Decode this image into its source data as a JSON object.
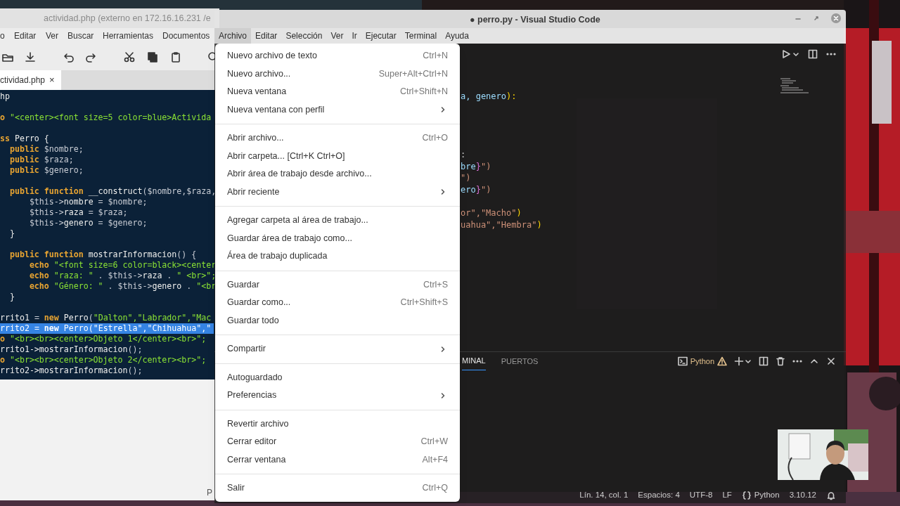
{
  "gedit": {
    "title": "actividad.php (externo en 172.16.16.231 /e",
    "menu": [
      "o",
      "Editar",
      "Ver",
      "Buscar",
      "Herramientas",
      "Documentos"
    ],
    "tab": {
      "label": "ctividad.php",
      "close": "×"
    },
    "code_lines": [
      {
        "kind": "code",
        "selected": false,
        "tokens": [
          {
            "kind": "plain",
            "text": "hp"
          }
        ]
      },
      {
        "kind": "blank"
      },
      {
        "kind": "code",
        "selected": false,
        "tokens": [
          {
            "kind": "keyword",
            "text": "o"
          },
          {
            "kind": "string",
            "text": " \"<center><font size=5 color=blue>Activida"
          }
        ]
      },
      {
        "kind": "blank"
      },
      {
        "kind": "code",
        "selected": false,
        "tokens": [
          {
            "kind": "keyword",
            "text": "ss"
          },
          {
            "kind": "plain",
            "text": " Perro {"
          }
        ]
      },
      {
        "kind": "code",
        "selected": false,
        "tokens": [
          {
            "kind": "keyword",
            "text": "  public"
          },
          {
            "kind": "variable",
            "text": " $nombre;"
          }
        ]
      },
      {
        "kind": "code",
        "selected": false,
        "tokens": [
          {
            "kind": "keyword",
            "text": "  public"
          },
          {
            "kind": "variable",
            "text": " $raza;"
          }
        ]
      },
      {
        "kind": "code",
        "selected": false,
        "tokens": [
          {
            "kind": "keyword",
            "text": "  public"
          },
          {
            "kind": "variable",
            "text": " $genero;"
          }
        ]
      },
      {
        "kind": "blank"
      },
      {
        "kind": "code",
        "selected": false,
        "tokens": [
          {
            "kind": "keyword",
            "text": "  public function"
          },
          {
            "kind": "plain",
            "text": " __construct"
          },
          {
            "kind": "variable",
            "text": "($nombre,$raza,"
          }
        ]
      },
      {
        "kind": "code",
        "selected": false,
        "tokens": [
          {
            "kind": "variable",
            "text": "      $this->"
          },
          {
            "kind": "plain",
            "text": "nombre"
          },
          {
            "kind": "variable",
            "text": " = $nombre;"
          }
        ]
      },
      {
        "kind": "code",
        "selected": false,
        "tokens": [
          {
            "kind": "variable",
            "text": "      $this->"
          },
          {
            "kind": "plain",
            "text": "raza"
          },
          {
            "kind": "variable",
            "text": " = $raza;"
          }
        ]
      },
      {
        "kind": "code",
        "selected": false,
        "tokens": [
          {
            "kind": "variable",
            "text": "      $this->"
          },
          {
            "kind": "plain",
            "text": "genero"
          },
          {
            "kind": "variable",
            "text": " = $genero;"
          }
        ]
      },
      {
        "kind": "code",
        "selected": false,
        "tokens": [
          {
            "kind": "plain",
            "text": "  }"
          }
        ]
      },
      {
        "kind": "blank"
      },
      {
        "kind": "code",
        "selected": false,
        "tokens": [
          {
            "kind": "keyword",
            "text": "  public function"
          },
          {
            "kind": "plain",
            "text": " mostrarInformacion"
          },
          {
            "kind": "variable",
            "text": "() {"
          }
        ]
      },
      {
        "kind": "code",
        "selected": false,
        "tokens": [
          {
            "kind": "keyword",
            "text": "      echo"
          },
          {
            "kind": "string",
            "text": " \"<font size=6 color=black><center"
          }
        ]
      },
      {
        "kind": "code",
        "selected": false,
        "tokens": [
          {
            "kind": "keyword",
            "text": "      echo"
          },
          {
            "kind": "string",
            "text": " \"raza: \""
          },
          {
            "kind": "variable",
            "text": " . $this->"
          },
          {
            "kind": "plain",
            "text": "raza"
          },
          {
            "kind": "variable",
            "text": " . "
          },
          {
            "kind": "string",
            "text": "\" <br>\";"
          }
        ]
      },
      {
        "kind": "code",
        "selected": false,
        "tokens": [
          {
            "kind": "keyword",
            "text": "      echo"
          },
          {
            "kind": "string",
            "text": " \"Género: \""
          },
          {
            "kind": "variable",
            "text": " . $this->"
          },
          {
            "kind": "plain",
            "text": "genero"
          },
          {
            "kind": "variable",
            "text": " . "
          },
          {
            "kind": "string",
            "text": "\"<br"
          }
        ]
      },
      {
        "kind": "code",
        "selected": false,
        "tokens": [
          {
            "kind": "plain",
            "text": "  }"
          }
        ]
      },
      {
        "kind": "blank"
      },
      {
        "kind": "code",
        "selected": false,
        "tokens": [
          {
            "kind": "plain",
            "text": "rrito1 "
          },
          {
            "kind": "variable",
            "text": "= "
          },
          {
            "kind": "keyword",
            "text": "new"
          },
          {
            "kind": "plain",
            "text": " Perro"
          },
          {
            "kind": "variable",
            "text": "("
          },
          {
            "kind": "string",
            "text": "\"Dalton\",\"Labrador\",\"Mac"
          }
        ]
      },
      {
        "kind": "code",
        "selected": true,
        "tokens": [
          {
            "kind": "plain",
            "text": "rrito2 "
          },
          {
            "kind": "variable",
            "text": "= "
          },
          {
            "kind": "keyword",
            "text": "new"
          },
          {
            "kind": "plain",
            "text": " Perro"
          },
          {
            "kind": "variable",
            "text": "("
          },
          {
            "kind": "string",
            "text": "\"Estrella\",\"Chihuahua\",\""
          }
        ]
      },
      {
        "kind": "code",
        "selected": false,
        "tokens": [
          {
            "kind": "keyword",
            "text": "o"
          },
          {
            "kind": "string",
            "text": " \"<br><br><center>Objeto 1</center><br>\";"
          }
        ]
      },
      {
        "kind": "code",
        "selected": false,
        "tokens": [
          {
            "kind": "plain",
            "text": "rrito1->mostrarInformacion"
          },
          {
            "kind": "variable",
            "text": "();"
          }
        ]
      },
      {
        "kind": "code",
        "selected": false,
        "tokens": [
          {
            "kind": "keyword",
            "text": "o"
          },
          {
            "kind": "string",
            "text": " \"<br><br><center>Objeto 2</center><br>\";"
          }
        ]
      },
      {
        "kind": "code",
        "selected": false,
        "tokens": [
          {
            "kind": "plain",
            "text": "rrito2->mostrarInformacion"
          },
          {
            "kind": "variable",
            "text": "();"
          }
        ]
      }
    ],
    "status_text": "P"
  },
  "vscode": {
    "title": "● perro.py - Visual Studio Code",
    "menu": [
      {
        "label": "Archivo",
        "selected": true
      },
      {
        "label": "Editar",
        "selected": false
      },
      {
        "label": "Selección",
        "selected": false
      },
      {
        "label": "Ver",
        "selected": false
      },
      {
        "label": "Ir",
        "selected": false
      },
      {
        "label": "Ejecutar",
        "selected": false
      },
      {
        "label": "Terminal",
        "selected": false
      },
      {
        "label": "Ayuda",
        "selected": false
      }
    ],
    "code_lines": [
      {
        "kind": "code",
        "tokens": [
          {
            "kind": "identifier",
            "text": "a, genero"
          },
          {
            "kind": "bracket",
            "text": "):"
          }
        ]
      },
      {
        "kind": "blank"
      },
      {
        "kind": "blank"
      },
      {
        "kind": "blank"
      },
      {
        "kind": "blank"
      },
      {
        "kind": "code",
        "tokens": [
          {
            "kind": "plain",
            "text": ":"
          }
        ]
      },
      {
        "kind": "code",
        "tokens": [
          {
            "kind": "identifier",
            "text": "bre"
          },
          {
            "kind": "brace",
            "text": "}"
          },
          {
            "kind": "string",
            "text": "\")"
          }
        ]
      },
      {
        "kind": "code",
        "tokens": [
          {
            "kind": "string",
            "text": "\")"
          }
        ]
      },
      {
        "kind": "code",
        "tokens": [
          {
            "kind": "identifier",
            "text": "ero"
          },
          {
            "kind": "brace",
            "text": "}"
          },
          {
            "kind": "string",
            "text": "\")"
          }
        ]
      },
      {
        "kind": "blank"
      },
      {
        "kind": "code",
        "tokens": [
          {
            "kind": "string",
            "text": "or\",\"Macho\""
          },
          {
            "kind": "bracket",
            "text": ")"
          }
        ]
      },
      {
        "kind": "code",
        "tokens": [
          {
            "kind": "string",
            "text": "uahua\",\"Hembra\""
          },
          {
            "kind": "bracket",
            "text": ")"
          }
        ]
      }
    ],
    "panel_tabs": [
      {
        "label": "MINAL",
        "selected": true
      },
      {
        "label": "PUERTOS",
        "selected": false
      }
    ],
    "terminal_profile": "Python",
    "status_items": [
      {
        "kind": "text",
        "text": "Lín. 14, col. 1"
      },
      {
        "kind": "text",
        "text": "Espacios: 4"
      },
      {
        "kind": "text",
        "text": "UTF-8"
      },
      {
        "kind": "text",
        "text": "LF"
      },
      {
        "kind": "language",
        "text": "Python"
      },
      {
        "kind": "text",
        "text": "3.10.12"
      }
    ],
    "file_menu": {
      "groups": [
        [
          {
            "label": "Nuevo archivo de texto",
            "shortcut": "Ctrl+N",
            "submenu": false
          },
          {
            "label": "Nuevo archivo...",
            "shortcut": "Super+Alt+Ctrl+N",
            "submenu": false
          },
          {
            "label": "Nueva ventana",
            "shortcut": "Ctrl+Shift+N",
            "submenu": false
          },
          {
            "label": "Nueva ventana con perfil",
            "submenu": true
          }
        ],
        [
          {
            "label": "Abrir archivo...",
            "shortcut": "Ctrl+O",
            "submenu": false
          },
          {
            "label": "Abrir carpeta... [Ctrl+K Ctrl+O]",
            "submenu": false
          },
          {
            "label": "Abrir área de trabajo desde archivo...",
            "submenu": false
          },
          {
            "label": "Abrir reciente",
            "submenu": true
          }
        ],
        [
          {
            "label": "Agregar carpeta al área de trabajo...",
            "submenu": false
          },
          {
            "label": "Guardar área de trabajo como...",
            "submenu": false
          },
          {
            "label": "Área de trabajo duplicada",
            "submenu": false
          }
        ],
        [
          {
            "label": "Guardar",
            "shortcut": "Ctrl+S",
            "submenu": false
          },
          {
            "label": "Guardar como...",
            "shortcut": "Ctrl+Shift+S",
            "submenu": false
          },
          {
            "label": "Guardar todo",
            "submenu": false
          }
        ],
        [
          {
            "label": "Compartir",
            "submenu": true
          }
        ],
        [
          {
            "label": "Autoguardado",
            "submenu": false
          },
          {
            "label": "Preferencias",
            "submenu": true
          }
        ],
        [
          {
            "label": "Revertir archivo",
            "submenu": false
          },
          {
            "label": "Cerrar editor",
            "shortcut": "Ctrl+W",
            "submenu": false
          },
          {
            "label": "Cerrar ventana",
            "shortcut": "Alt+F4",
            "submenu": false
          }
        ],
        [
          {
            "label": "Salir",
            "shortcut": "Ctrl+Q",
            "submenu": false
          }
        ]
      ]
    }
  }
}
